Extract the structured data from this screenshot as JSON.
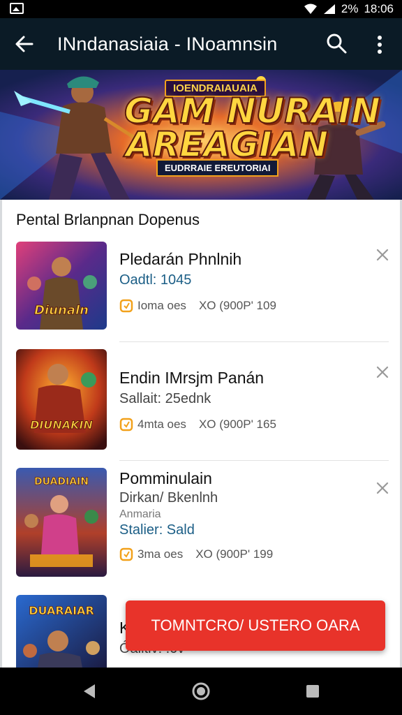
{
  "status_bar": {
    "time": "18:06",
    "battery_text": "2%",
    "icons": [
      "gallery-icon",
      "wifi-icon",
      "signal-icon"
    ]
  },
  "app_bar": {
    "title": "INndanasiaia - INoamnsin",
    "icons": [
      "back-arrow-icon",
      "search-icon",
      "more-vert-icon"
    ]
  },
  "banner": {
    "tagline": "IOENDRAIAUAIA",
    "logo_line1": "GAM NURAIN",
    "logo_line2": "AREAGIAN",
    "subtitle": "EUDRRAIE EREUTORIAI"
  },
  "section_title": "Pental Brlanpnan Dopenus",
  "items": [
    {
      "title": "Pledarán Phnlnih",
      "subtitle": "Oadtl: 1045",
      "coins": "Ioma oes",
      "price": "XO (900P' 109",
      "thumb_text": "Diunaln"
    },
    {
      "title": "Endin IMrsjm Panán",
      "subtitle": "Sallait: 25ednk",
      "coins": "4mta oes",
      "price": "XO (900P' 165",
      "thumb_text": "DIUNAKIN"
    },
    {
      "title": "Pomminulain",
      "line2": "Dirkan/  Bkenlnh",
      "line3": "Anmaria",
      "subtitle": "Stalier: Sald",
      "coins": "3ma oes",
      "price": "XO (900P' 199",
      "thumb_text": "DUADIAIN"
    },
    {
      "title": "K",
      "subtitle": "Óalitiv: .0v",
      "thumb_text": "DUARAIAR"
    }
  ],
  "fab_label": "TOMNTCRO/ USTERO OARA",
  "nav_bar": {
    "icons": [
      "back-triangle-icon",
      "home-circle-icon",
      "recents-square-icon"
    ]
  },
  "colors": {
    "app_bar": "#0b1b26",
    "accent": "#e8332a",
    "link_blue": "#1b5e86",
    "coin_orange": "#f2a11b"
  }
}
